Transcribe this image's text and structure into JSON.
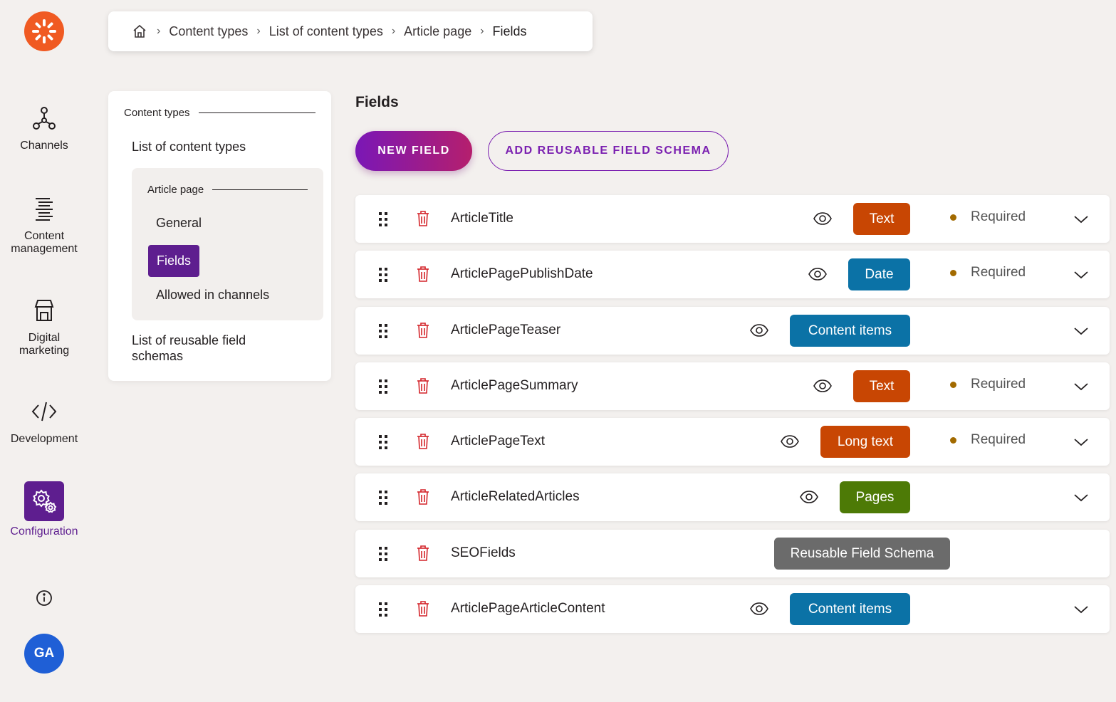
{
  "rail": {
    "items": [
      {
        "label": "Channels",
        "icon": "channels-icon"
      },
      {
        "label": "Content management",
        "icon": "content-management-icon"
      },
      {
        "label": "Digital marketing",
        "icon": "store-icon"
      },
      {
        "label": "Development",
        "icon": "code-icon"
      },
      {
        "label": "Configuration",
        "icon": "gear-icon"
      }
    ],
    "avatar": "GA",
    "accent": "#5e1e8f",
    "logo_color": "#f05a22"
  },
  "breadcrumb": {
    "items": [
      "Content types",
      "List of content types",
      "Article page",
      "Fields"
    ]
  },
  "sidenav": {
    "section_title": "Content types",
    "list_link": "List of content types",
    "group_title": "Article page",
    "group_items": [
      "General",
      "Fields",
      "Allowed in channels"
    ],
    "active_item": "Fields",
    "bottom_link": "List of reusable field schemas"
  },
  "main": {
    "title": "Fields",
    "new_field_label": "NEW FIELD",
    "add_schema_label": "ADD REUSABLE FIELD SCHEMA",
    "required_label": "Required",
    "fields": [
      {
        "name": "ArticleTitle",
        "type": "Text",
        "type_color": "#c84603",
        "required": true,
        "visible": true,
        "expandable": true
      },
      {
        "name": "ArticlePagePublishDate",
        "type": "Date",
        "type_color": "#0b72a6",
        "required": true,
        "visible": true,
        "expandable": true
      },
      {
        "name": "ArticlePageTeaser",
        "type": "Content items",
        "type_color": "#0b72a6",
        "required": false,
        "visible": true,
        "expandable": true
      },
      {
        "name": "ArticlePageSummary",
        "type": "Text",
        "type_color": "#c84603",
        "required": true,
        "visible": true,
        "expandable": true
      },
      {
        "name": "ArticlePageText",
        "type": "Long text",
        "type_color": "#c84603",
        "required": true,
        "visible": true,
        "expandable": true
      },
      {
        "name": "ArticleRelatedArticles",
        "type": "Pages",
        "type_color": "#4d7a06",
        "required": false,
        "visible": true,
        "expandable": true
      },
      {
        "name": "SEOFields",
        "type": "Reusable Field Schema",
        "type_color": "#6b6b6b",
        "required": false,
        "visible": false,
        "expandable": false
      },
      {
        "name": "ArticlePageArticleContent",
        "type": "Content items",
        "type_color": "#0b72a6",
        "required": false,
        "visible": true,
        "expandable": true
      }
    ]
  }
}
